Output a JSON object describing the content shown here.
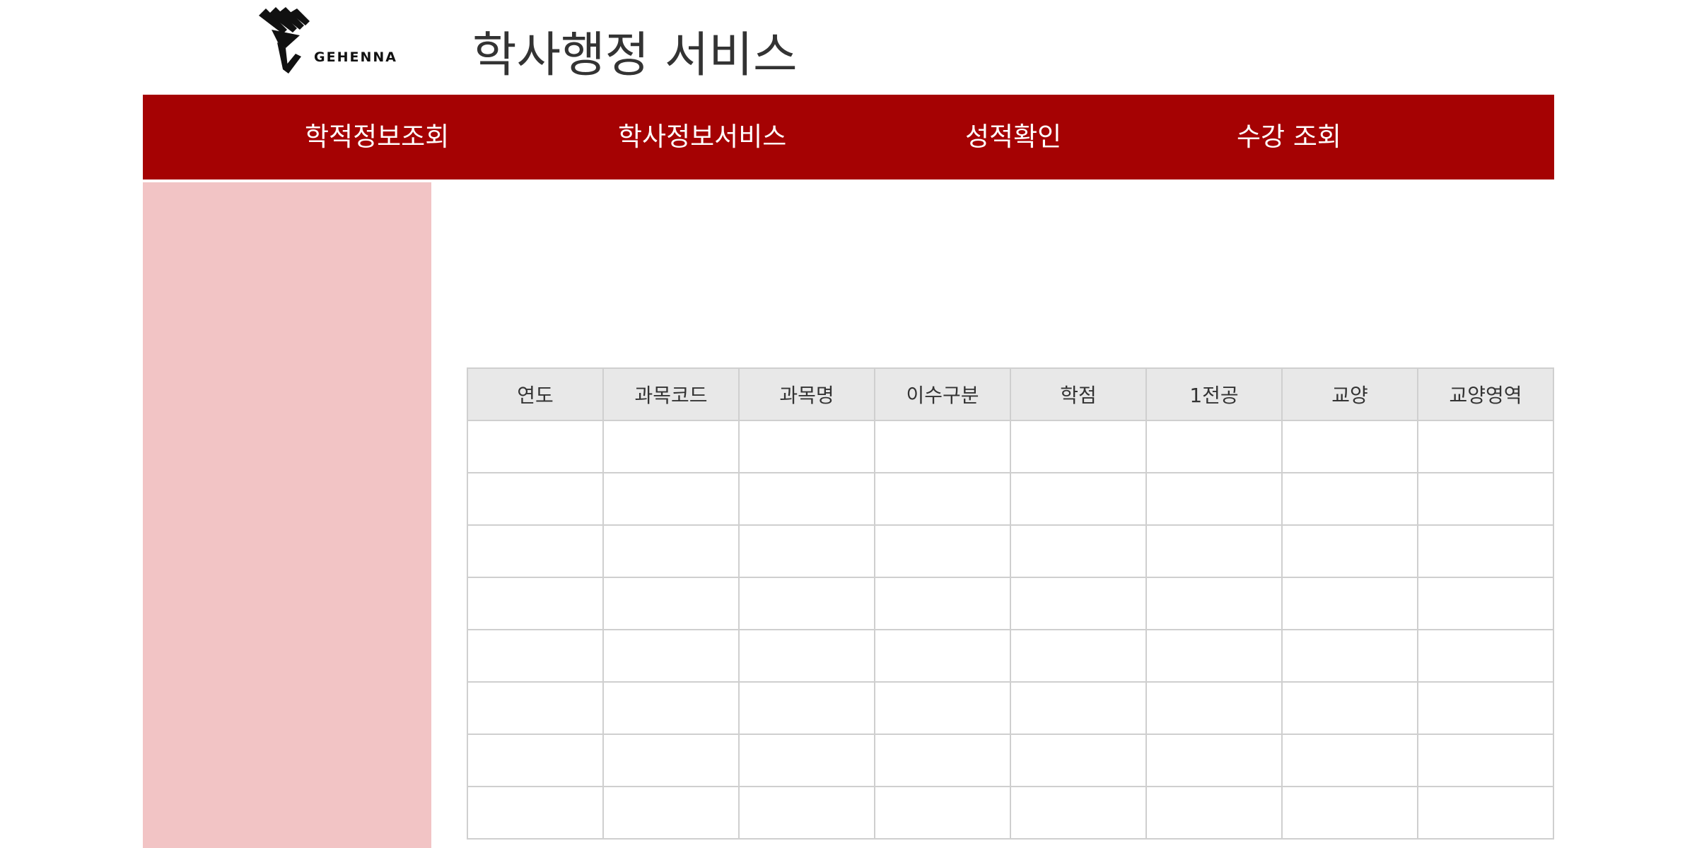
{
  "header": {
    "logo_text": "GEHENNA",
    "title": "학사행정 서비스"
  },
  "nav": {
    "items": [
      {
        "label": "학적정보조회"
      },
      {
        "label": "학사정보서비스"
      },
      {
        "label": "성적확인"
      },
      {
        "label": "수강 조회"
      }
    ]
  },
  "table": {
    "headers": [
      "연도",
      "과목코드",
      "과목명",
      "이수구분",
      "학점",
      "1전공",
      "교양",
      "교양영역"
    ],
    "rows": [
      [
        "",
        "",
        "",
        "",
        "",
        "",
        "",
        ""
      ],
      [
        "",
        "",
        "",
        "",
        "",
        "",
        "",
        ""
      ],
      [
        "",
        "",
        "",
        "",
        "",
        "",
        "",
        ""
      ],
      [
        "",
        "",
        "",
        "",
        "",
        "",
        "",
        ""
      ],
      [
        "",
        "",
        "",
        "",
        "",
        "",
        "",
        ""
      ],
      [
        "",
        "",
        "",
        "",
        "",
        "",
        "",
        ""
      ],
      [
        "",
        "",
        "",
        "",
        "",
        "",
        "",
        ""
      ],
      [
        "",
        "",
        "",
        "",
        "",
        "",
        "",
        ""
      ]
    ]
  },
  "colors": {
    "nav_background": "#a50203",
    "sidebar_background": "#f2c4c5",
    "table_header_background": "#e8e8e8"
  }
}
